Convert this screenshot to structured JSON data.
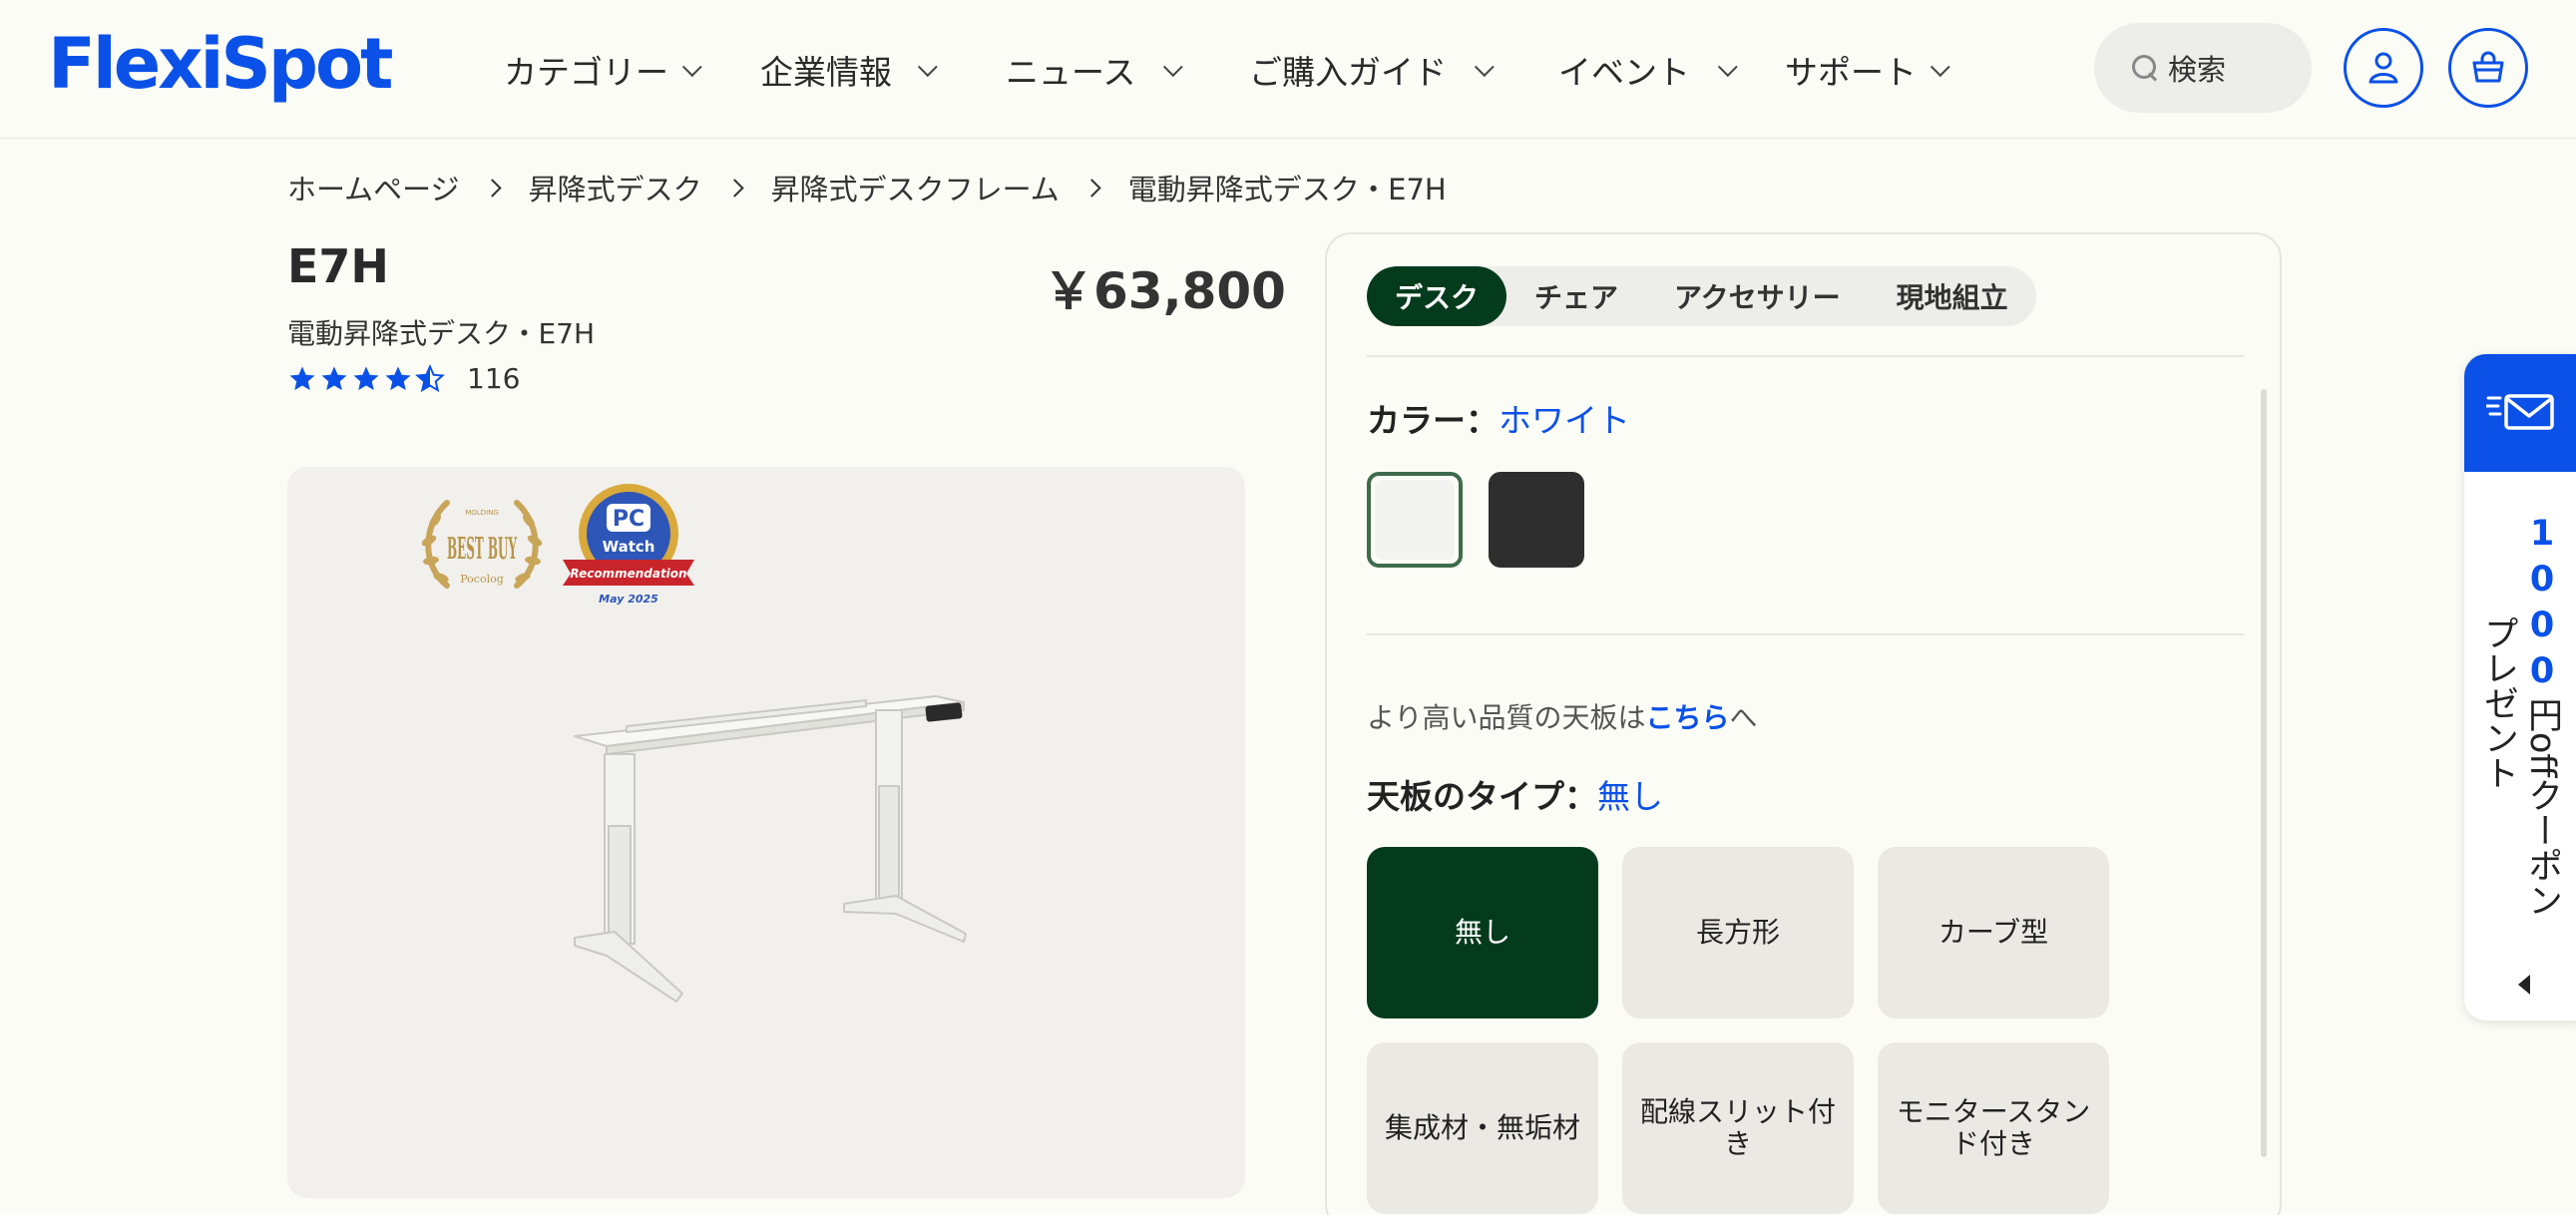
{
  "brand": {
    "logo_text": "FlexiSpot",
    "accent": "#0b51e8",
    "dark_green": "#053b1d"
  },
  "header": {
    "nav": [
      {
        "label": "カテゴリー"
      },
      {
        "label": "企業情報"
      },
      {
        "label": "ニュース"
      },
      {
        "label": "ご購入ガイド"
      },
      {
        "label": "イベント"
      },
      {
        "label": "サポート"
      }
    ],
    "search_placeholder": "検索",
    "icons": [
      "user-icon",
      "cart-icon"
    ]
  },
  "breadcrumb": [
    "ホームページ",
    "昇降式デスク",
    "昇降式デスクフレーム",
    "電動昇降式デスク・E7H"
  ],
  "product": {
    "model": "E7H",
    "name": "電動昇降式デスク・E7H",
    "price": "￥63,800",
    "rating": 4.5,
    "review_count": "116",
    "badges": {
      "best_buy_small": "MOLDING",
      "best_buy_main": "BEST BUY",
      "best_buy_sub": "Pocolog",
      "pcwatch_logo": "PC",
      "pcwatch_word": "Watch",
      "pcwatch_ribbon": "Recommendation",
      "pcwatch_date": "May 2025"
    }
  },
  "options": {
    "tabs": [
      {
        "label": "デスク",
        "active": true
      },
      {
        "label": "チェア",
        "active": false
      },
      {
        "label": "アクセサリー",
        "active": false
      },
      {
        "label": "現地組立",
        "active": false
      }
    ],
    "color_label": "カラー：",
    "color_value": "ホワイト",
    "swatches": [
      {
        "name": "ホワイト",
        "hex": "#f3f3f1",
        "selected": true
      },
      {
        "name": "ブラック",
        "hex": "#2e2e2e",
        "selected": false
      }
    ],
    "note_prefix": "より高い品質の天板は",
    "note_link": "こちら",
    "note_suffix": "へ",
    "top_type_label": "天板のタイプ：",
    "top_type_value": "無し",
    "top_types": [
      "無し",
      "長方形",
      "カーブ型",
      "集成材・無垢材",
      "配線スリット付き",
      "モニタースタンド付き"
    ]
  },
  "coupon": {
    "col_right_digits": "1000",
    "col_right_rest": "円offクーポン",
    "col_left": "プレゼント"
  }
}
